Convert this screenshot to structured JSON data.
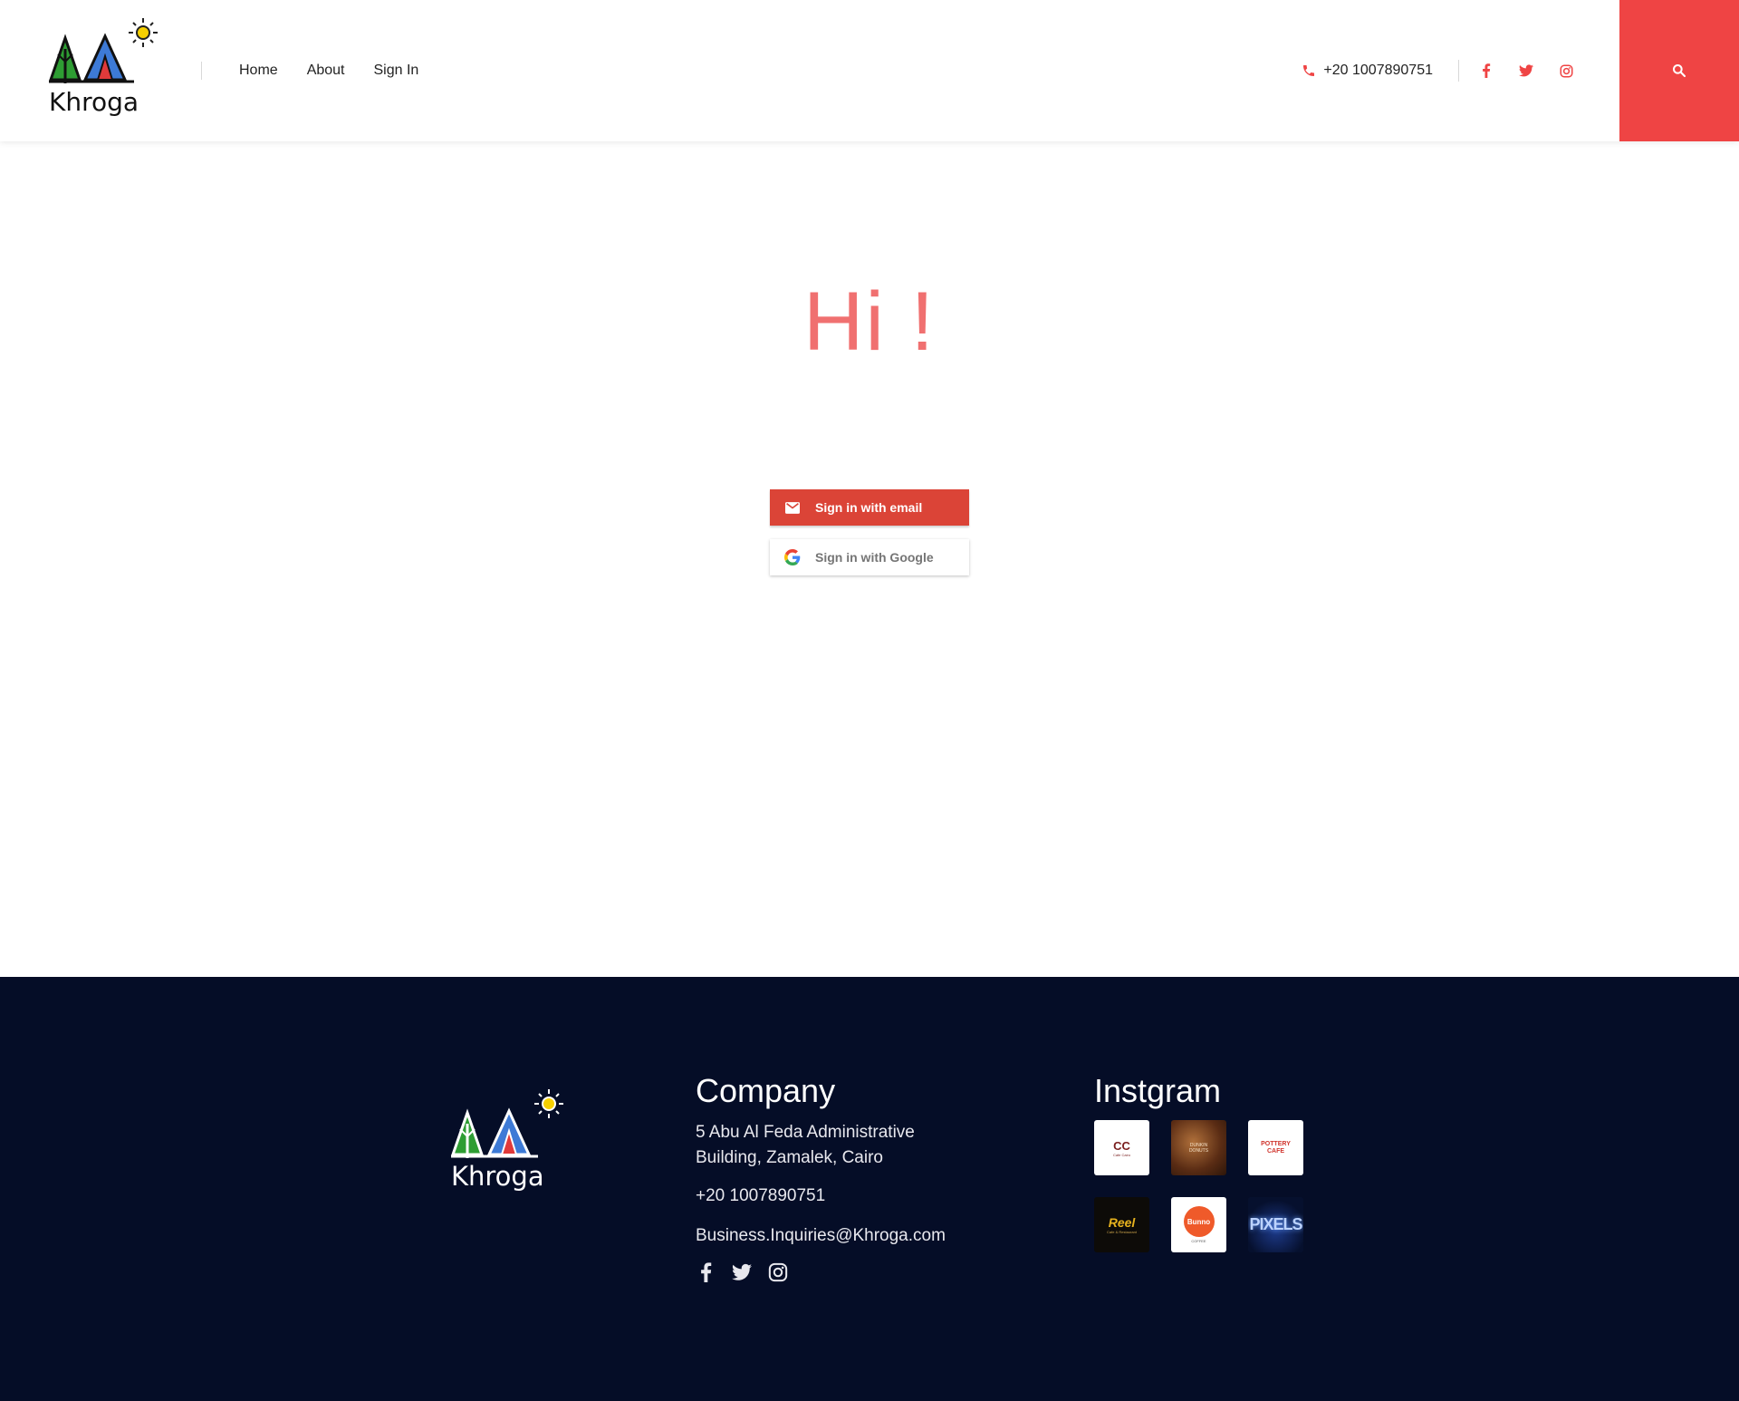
{
  "brand": {
    "name": "Khroga"
  },
  "nav": {
    "items": [
      "Home",
      "About",
      "Sign In"
    ]
  },
  "header": {
    "phone": "+20 1007890751",
    "socials": [
      "facebook-icon",
      "twitter-icon",
      "instagram-icon"
    ]
  },
  "main": {
    "greeting": "Hi !",
    "email_button": "Sign in with email",
    "google_button": "Sign in with Google"
  },
  "footer": {
    "company": {
      "heading": "Company",
      "address": "5 Abu Al Feda Administrative Building, Zamalek, Cairo",
      "phone": "+20 1007890751",
      "email": "Business.Inquiries@Khroga.com"
    },
    "instagram": {
      "heading": "Instgram",
      "tiles": [
        {
          "label": "CC",
          "sub": "Cafe Cairo"
        },
        {
          "label": "DUNKIN",
          "sub": "DONUTS"
        },
        {
          "label": "POTTERY",
          "sub": "CAFE"
        },
        {
          "label": "Reel",
          "sub": "Cafe & Restaurant"
        },
        {
          "label": "Bunno",
          "sub": "COFFEE"
        },
        {
          "label": "PIXELS",
          "sub": ""
        }
      ]
    }
  },
  "colors": {
    "accent": "#ef4444",
    "email_btn": "#db4437",
    "footer_bg": "#050d27",
    "greeting": "#f07070"
  }
}
